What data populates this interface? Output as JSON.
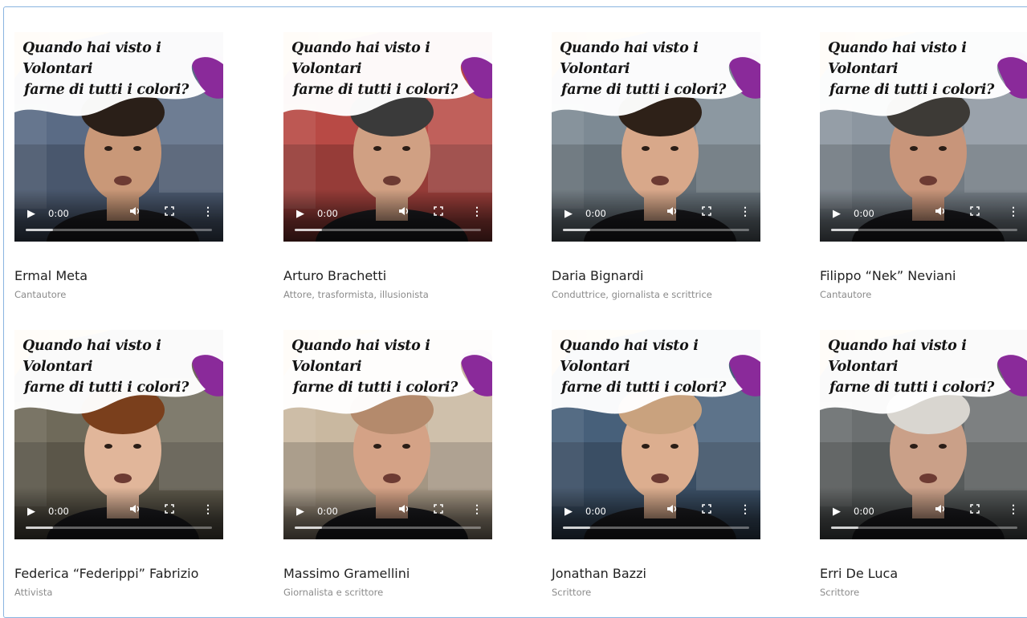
{
  "overlay_text": {
    "line1": "Quando hai visto i Volontari",
    "line2": "farne di tutti i colori?"
  },
  "player": {
    "time": "0:00",
    "icons": [
      "play-icon",
      "volume-icon",
      "fullscreen-icon",
      "more-options-icon"
    ]
  },
  "colors": {
    "wave_orange": "#f3a53b",
    "wave_purple": "#8a2a9a",
    "frame_border": "#8ab4e0",
    "name_text": "#222222",
    "role_text": "#8b8b8b"
  },
  "cards": [
    {
      "name": "Ermal Meta",
      "role": "Cantautore",
      "bg": "#5a6b85",
      "skin": "#c99878",
      "hair": "#2a1f18"
    },
    {
      "name": "Arturo Brachetti",
      "role": "Attore, trasformista, illusionista",
      "bg": "#b84a45",
      "skin": "#d0a083",
      "hair": "#3a3a3a"
    },
    {
      "name": "Daria Bignardi",
      "role": "Conduttrice, giornalista e scrittrice",
      "bg": "#7d8a94",
      "skin": "#d8a88a",
      "hair": "#2e2118"
    },
    {
      "name": "Filippo “Nek” Neviani",
      "role": "Cantautore",
      "bg": "#8c96a0",
      "skin": "#c8957a",
      "hair": "#3d3a36"
    },
    {
      "name": "Federica “Federippi” Fabrizio",
      "role": "Attivista",
      "bg": "#6f6a5a",
      "skin": "#e1b69a",
      "hair": "#7a3f1c"
    },
    {
      "name": "Massimo Gramellini",
      "role": "Giornalista e scrittore",
      "bg": "#c9b8a0",
      "skin": "#d4a286",
      "hair": "#b48a6c"
    },
    {
      "name": "Jonathan Bazzi",
      "role": "Scrittore",
      "bg": "#47607a",
      "skin": "#dcae8f",
      "hair": "#c9a27e"
    },
    {
      "name": "Erri De Luca",
      "role": "Scrittore",
      "bg": "#6b6f70",
      "skin": "#caa088",
      "hair": "#d9d6d0"
    }
  ]
}
